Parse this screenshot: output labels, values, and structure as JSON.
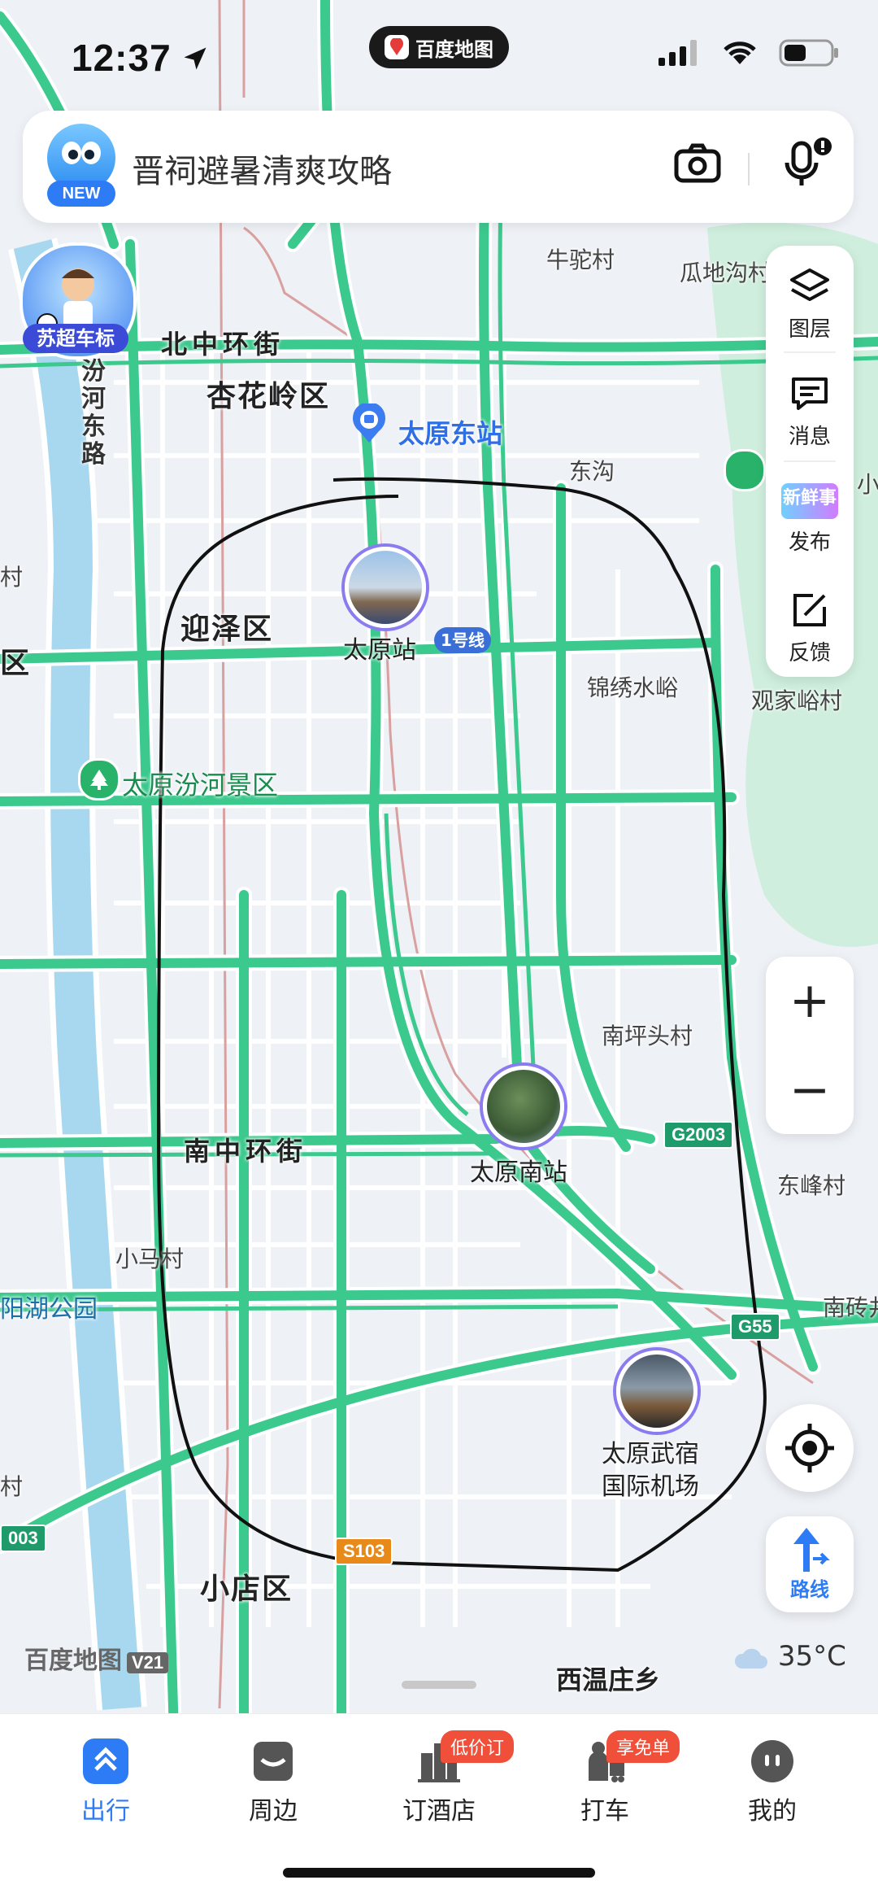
{
  "status": {
    "time": "12:37",
    "app_pill": "百度地图"
  },
  "search": {
    "placeholder": "晋祠避暑清爽攻略",
    "new_badge": "NEW"
  },
  "promo": {
    "label": "苏超车标"
  },
  "side_panel": {
    "items": [
      {
        "label": "图层",
        "icon": "layers-icon"
      },
      {
        "label": "消息",
        "icon": "message-icon"
      },
      {
        "label": "发布",
        "icon": "publish-icon",
        "tag": "新鲜事"
      },
      {
        "label": "反馈",
        "icon": "feedback-icon"
      }
    ]
  },
  "zoom": {
    "plus": "+",
    "minus": "−"
  },
  "route_button": {
    "label": "路线"
  },
  "map": {
    "districts": {
      "xinghualing": "杏花岭区",
      "yingze": "迎泽区",
      "xiaodian": "小店区"
    },
    "roads": {
      "north_ring": "北中环街",
      "south_ring": "南中环街",
      "fen_east": "汾河东路"
    },
    "places": {
      "niutuo": "牛驼村",
      "guadigou": "瓜地沟村",
      "donggou": "东沟",
      "jinxiu": "锦绣水峪",
      "guanjia": "观家峪村",
      "nanping": "南坪头村",
      "dongfeng": "东峰村",
      "nanzhuan": "南砖井",
      "xiaoma": "小马村",
      "yanghu": "阳湖公园",
      "xiwenzhuang": "西温庄乡",
      "left_cut1": "村",
      "left_cut2": "区",
      "left_cut3": "村",
      "right_cut1": "小"
    },
    "pois": {
      "taiyuan_east": "太原东站",
      "taiyuan_station": "太原站",
      "line1": "1号线",
      "fenhe_scenic": "太原汾河景区",
      "taiyuan_south": "太原南站",
      "airport_line1": "太原武宿",
      "airport_line2": "国际机场"
    },
    "shields": {
      "g2003": "G2003",
      "g55": "G55",
      "s103": "S103",
      "left003": "003"
    }
  },
  "brand": {
    "name": "百度地图",
    "version": "V21"
  },
  "weather": {
    "temp": "35°C"
  },
  "tabs": [
    {
      "label": "出行",
      "icon": "travel-icon",
      "active": true
    },
    {
      "label": "周边",
      "icon": "nearby-icon"
    },
    {
      "label": "订酒店",
      "icon": "hotel-icon",
      "badge": "低价订"
    },
    {
      "label": "打车",
      "icon": "taxi-icon",
      "badge": "享免单"
    },
    {
      "label": "我的",
      "icon": "profile-icon"
    }
  ],
  "colors": {
    "accent": "#2e7bf6",
    "road_green": "#3cc98e",
    "water": "#a8d8f0",
    "park": "#cfeedd"
  }
}
